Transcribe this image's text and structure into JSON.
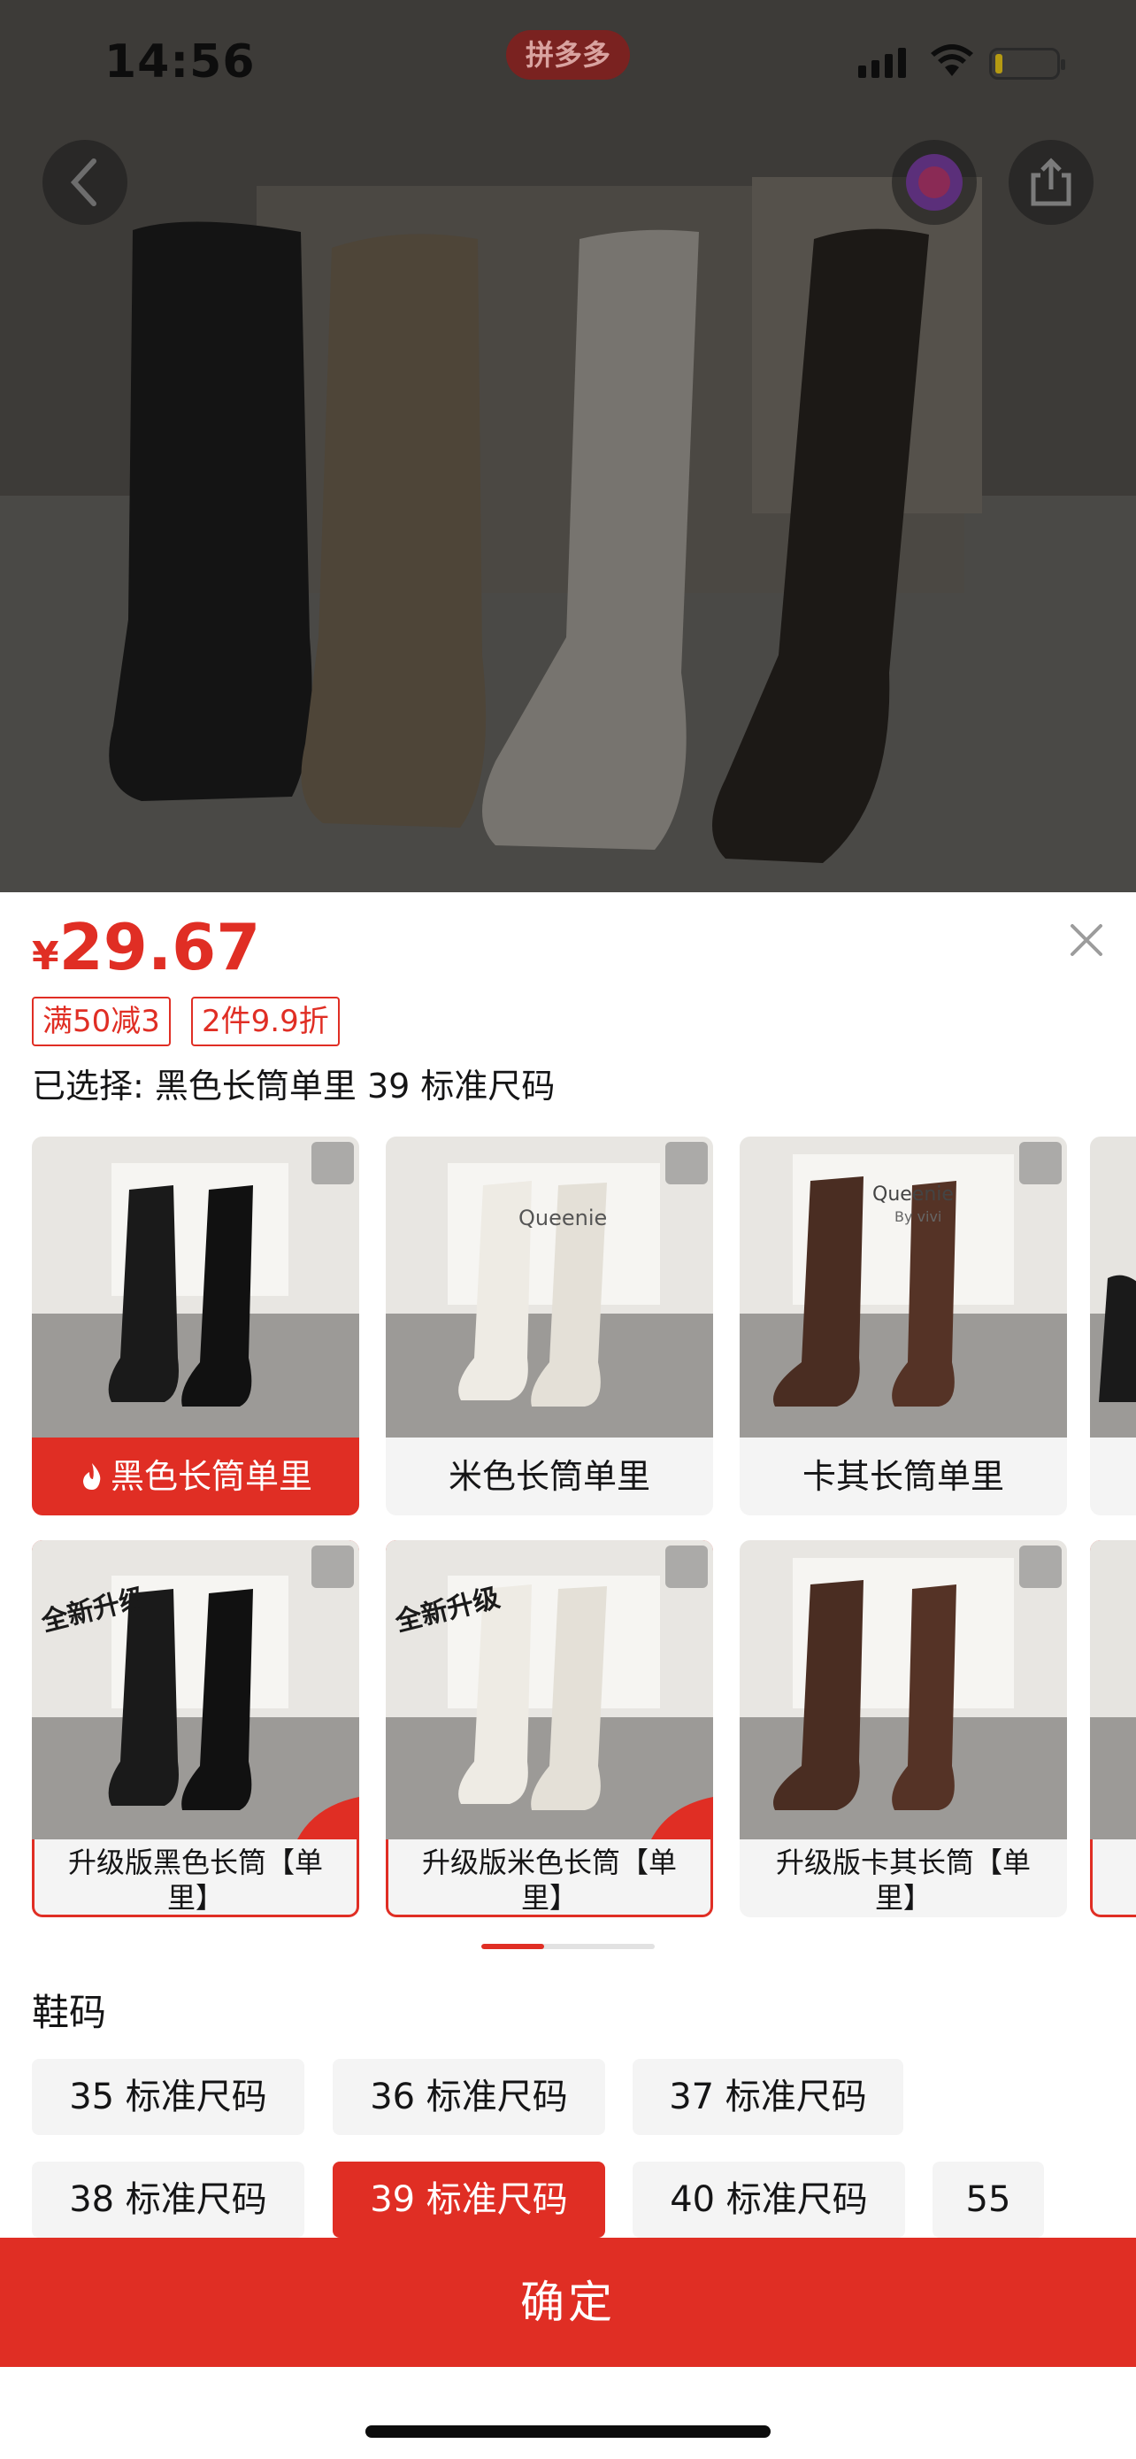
{
  "status_bar": {
    "time": "14:56",
    "app_pill": "拼多多",
    "battery_level": 0.12
  },
  "product": {
    "price_currency": "¥",
    "price": "29.67",
    "promotions": [
      "满50减3",
      "2件9.9折"
    ],
    "selected_prefix": "已选择: ",
    "selected_value": "黑色长筒单里 39 标准尺码",
    "photo_brand_text": [
      "Queenie",
      "By vivi"
    ]
  },
  "variants": {
    "row1": [
      {
        "label": "黑色长筒单里",
        "selected": true
      },
      {
        "label": "米色长筒单里",
        "selected": false
      },
      {
        "label": "卡其长筒单里",
        "selected": false
      }
    ],
    "row2": [
      {
        "label": "升级版黑色长筒【单里】",
        "badge": "全新升级"
      },
      {
        "label": "升级版米色长筒【单里】",
        "badge": "全新升级"
      },
      {
        "label": "升级版卡其长筒【单里】"
      }
    ],
    "scroll_progress": 0.36
  },
  "sizes": {
    "title": "鞋码",
    "options": [
      "35 标准尺码",
      "36 标准尺码",
      "37 标准尺码",
      "38 标准尺码",
      "39 标准尺码",
      "40 标准尺码",
      "55"
    ],
    "selected": "39 标准尺码"
  },
  "actions": {
    "confirm": "确定"
  },
  "colors": {
    "accent": "#e02e24",
    "chip_bg": "#f4f4f4"
  },
  "icons": [
    "back-icon",
    "chat-avatar-icon",
    "share-icon",
    "close-icon",
    "expand-icon",
    "flame-icon",
    "signal-icon",
    "wifi-icon",
    "battery-icon"
  ]
}
